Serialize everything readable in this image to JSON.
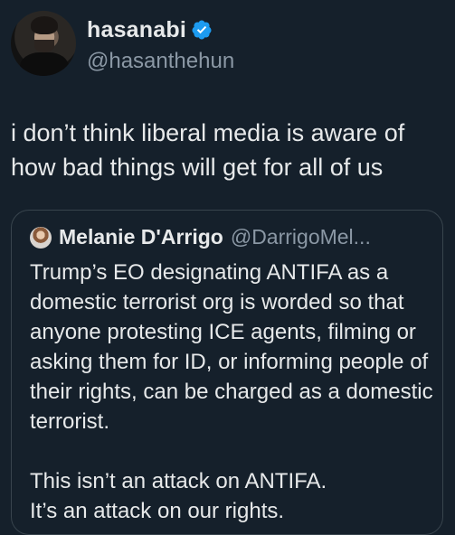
{
  "author": {
    "display_name": "hasanabi",
    "handle": "@hasanthehun",
    "verified_color": "#1d9bf0"
  },
  "tweet": {
    "text": "i don’t think liberal media is aware of how bad things will get for all of us"
  },
  "quoted_tweet": {
    "display_name": "Melanie D'Arrigo",
    "handle": "@DarrigoMel...",
    "text": "Trump’s EO designating ANTIFA as a domestic terrorist org is worded so that anyone protesting ICE agents, filming or asking them for ID, or informing people of their rights, can be charged as a domestic terrorist.\n\nThis isn’t an attack on ANTIFA.\nIt’s an attack on our rights."
  },
  "colors": {
    "background": "#15202b",
    "text_primary": "#e7e9ea",
    "text_secondary": "#8b98a5",
    "border": "#38444d"
  },
  "icons": {
    "verified": "verified-badge-icon"
  }
}
